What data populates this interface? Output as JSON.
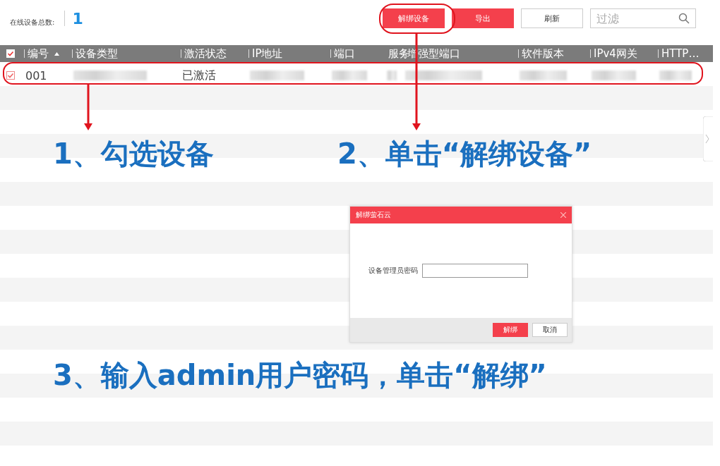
{
  "toolbar": {
    "count_label": "在线设备总数:",
    "count": "1",
    "buttons": [
      {
        "label": "解绑设备",
        "kind": "primary"
      },
      {
        "label": "导出",
        "kind": "primary"
      },
      {
        "label": "刷新",
        "kind": "plain"
      }
    ],
    "filter": {
      "placeholder": "过滤"
    }
  },
  "table": {
    "select_all": {
      "checked": true
    },
    "columns": [
      {
        "label": "编号",
        "sorted": true
      },
      {
        "label": "设备类型",
        "sorted": false
      },
      {
        "label": "激活状态",
        "sorted": false
      },
      {
        "label": "IP地址",
        "sorted": false
      },
      {
        "label": "端口",
        "sorted": false
      },
      {
        "label": "服务",
        "sorted": false
      },
      {
        "label": "增强型端口",
        "sorted": false
      },
      {
        "label": "软件版本",
        "sorted": false
      },
      {
        "label": "IPv4网关",
        "sorted": false
      },
      {
        "label": "HTTP…",
        "sorted": false
      }
    ],
    "rows": [
      {
        "checked": true,
        "cells": [
          {
            "kind": "text",
            "text": "001"
          },
          {
            "kind": "blurred"
          },
          {
            "kind": "text",
            "text": "已激活"
          },
          {
            "kind": "blurred"
          },
          {
            "kind": "blurred"
          },
          {
            "kind": "blurred"
          },
          {
            "kind": "blurred"
          },
          {
            "kind": "blurred"
          },
          {
            "kind": "blurred"
          },
          {
            "kind": "blurred"
          }
        ]
      }
    ]
  },
  "callouts": [
    {
      "text": "1、勾选设备"
    },
    {
      "text": "2、单击“解绑设备”"
    },
    {
      "text": "3、输入admin用户密码，单击“解绑”"
    }
  ],
  "dialog": {
    "title": "解绑萤石云",
    "field_label": "设备管理员密码",
    "buttons": [
      {
        "label": "解绑",
        "kind": "primary"
      },
      {
        "label": "取消",
        "kind": "plain"
      }
    ]
  }
}
